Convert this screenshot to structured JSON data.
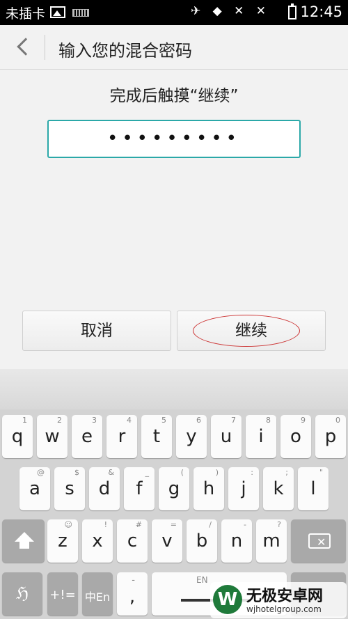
{
  "status_bar": {
    "carrier": "未插卡",
    "signal_labels": "✈ ◆ ✕ ✕",
    "time": "12:45"
  },
  "header": {
    "title": "输入您的混合密码"
  },
  "hint": "完成后触摸“继续”",
  "password": {
    "masked_value": "•••••••••"
  },
  "buttons": {
    "cancel": "取消",
    "continue": "继续"
  },
  "keyboard": {
    "row1": [
      [
        "q",
        "1"
      ],
      [
        "w",
        "2"
      ],
      [
        "e",
        "3"
      ],
      [
        "r",
        "4"
      ],
      [
        "t",
        "5"
      ],
      [
        "y",
        "6"
      ],
      [
        "u",
        "7"
      ],
      [
        "i",
        "8"
      ],
      [
        "o",
        "9"
      ],
      [
        "p",
        "0"
      ]
    ],
    "row2": [
      [
        "a",
        "@"
      ],
      [
        "s",
        "$"
      ],
      [
        "d",
        "&"
      ],
      [
        "f",
        "_"
      ],
      [
        "g",
        "("
      ],
      [
        "h",
        ")"
      ],
      [
        "j",
        ":"
      ],
      [
        "k",
        ";"
      ],
      [
        "l",
        "\""
      ]
    ],
    "row3": [
      [
        "z",
        "☺"
      ],
      [
        "x",
        "!"
      ],
      [
        "c",
        "#"
      ],
      [
        "v",
        "="
      ],
      [
        "b",
        "/"
      ],
      [
        "n",
        "-"
      ],
      [
        "m",
        "?"
      ]
    ],
    "symbols_label": "+!=",
    "lang_label": "中En",
    "comma_label": ",",
    "comma_hint": "-",
    "space_hint": "EN"
  },
  "watermark": {
    "title": "无极安卓网",
    "url": "wjhotelgroup.com"
  }
}
